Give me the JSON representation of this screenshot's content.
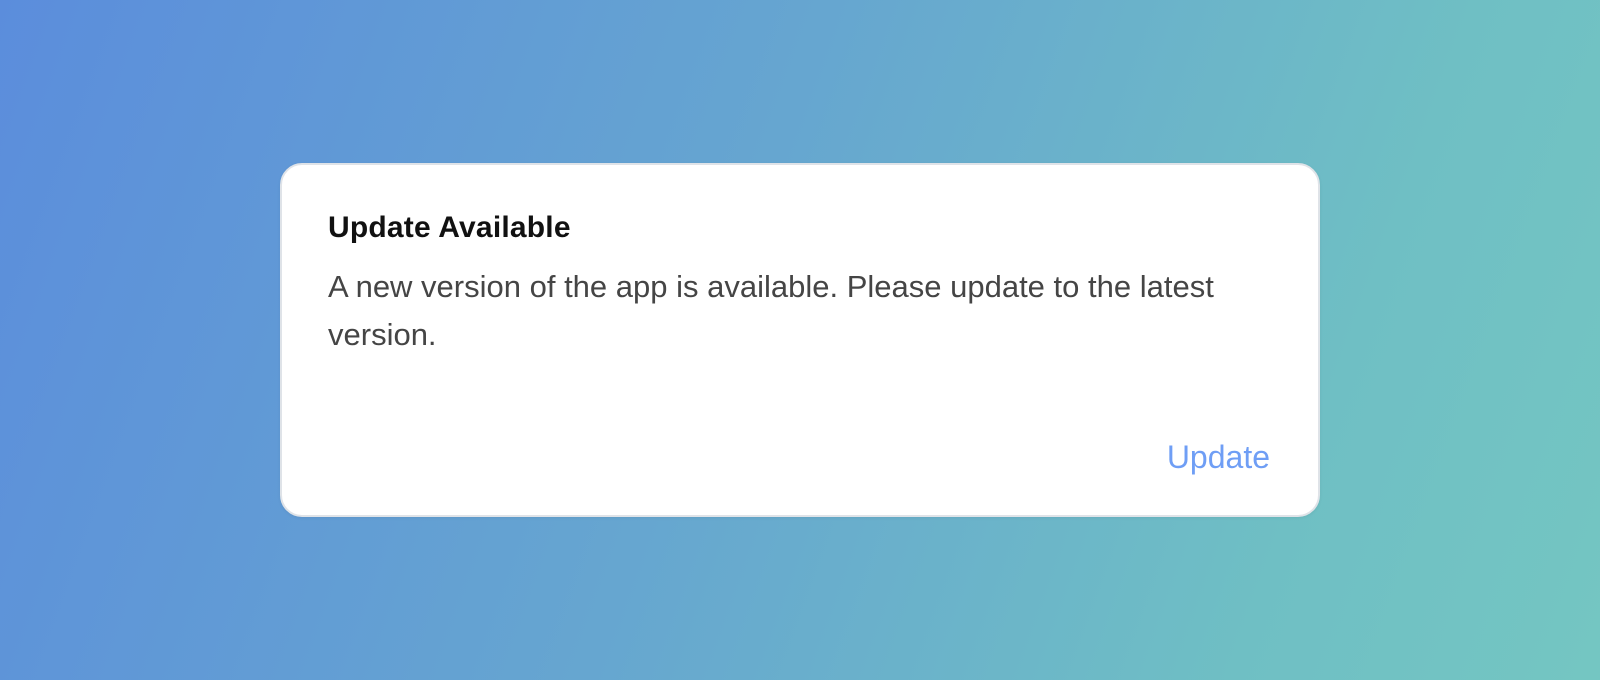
{
  "dialog": {
    "title": "Update Available",
    "message": "A new version of the app is available. Please update to the latest version.",
    "update_label": "Update"
  },
  "colors": {
    "background_start": "#5b8ddc",
    "background_end": "#74c6c2",
    "card": "#ffffff",
    "title": "#111111",
    "message": "#454545",
    "accent": "#6f9ef5"
  }
}
